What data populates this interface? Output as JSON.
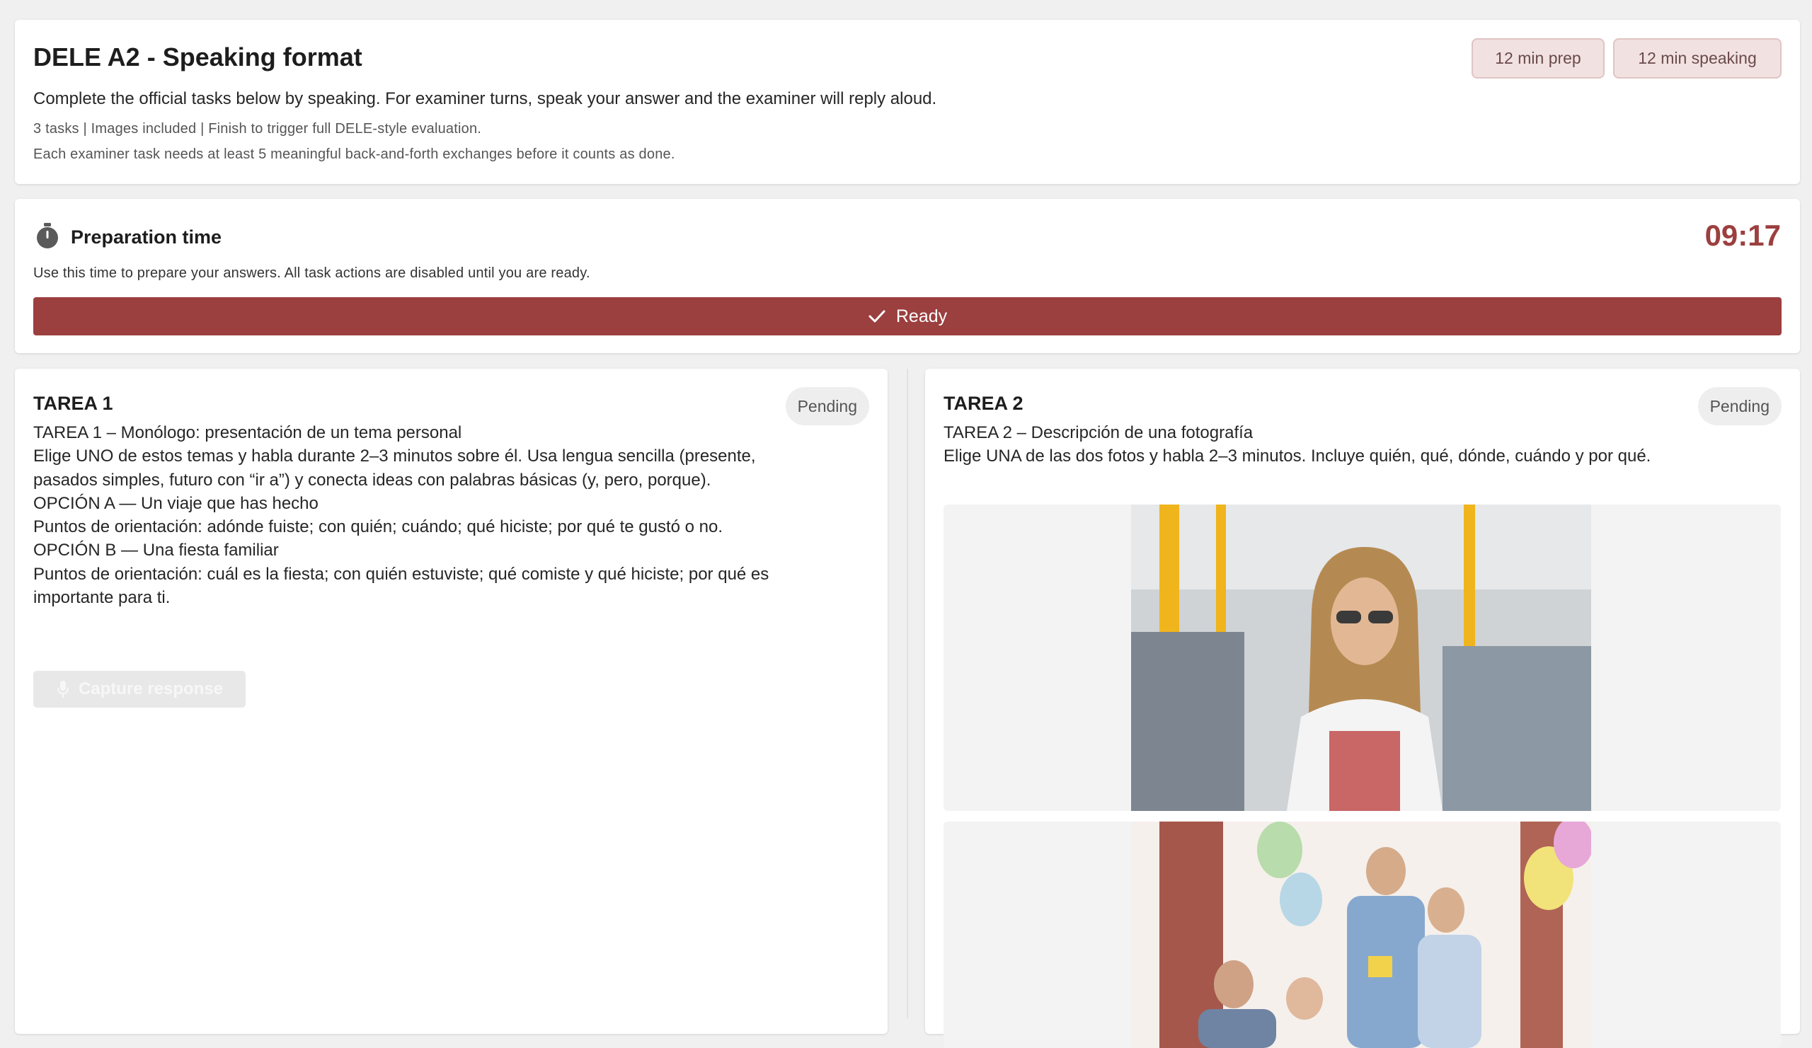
{
  "header": {
    "title": "DELE A2 - Speaking format",
    "subtitle": "Complete the official tasks below by speaking. For examiner turns, speak your answer and the examiner will reply aloud.",
    "meta_line1": "3 tasks | Images included | Finish to trigger full DELE-style evaluation.",
    "meta_line2": "Each examiner task needs at least 5 meaningful back-and-forth exchanges before it counts as done.",
    "chips": [
      "12 min prep",
      "12 min speaking"
    ]
  },
  "prep": {
    "icon": "stopwatch-icon",
    "title": "Preparation time",
    "description": "Use this time to prepare your answers. All task actions are disabled until you are ready.",
    "timer": "09:17",
    "ready_label": "Ready",
    "accent_color": "#9c3f3f"
  },
  "tasks": [
    {
      "title": "TAREA 1",
      "status": "Pending",
      "lines": [
        "TAREA 1 – Monólogo: presentación de un tema personal",
        "Elige UNO de estos temas y habla durante 2–3 minutos sobre él. Usa lengua sencilla (presente, pasados simples, futuro con “ir a”) y conecta ideas con palabras básicas (y, pero, porque).",
        "OPCIÓN A — Un viaje que has hecho",
        "Puntos de orientación: adónde fuiste; con quién; cuándo; qué hiciste; por qué te gustó o no.",
        "OPCIÓN B — Una fiesta familiar",
        "Puntos de orientación: cuál es la fiesta; con quién estuviste; qué comiste y qué hiciste; por qué es importante para ti."
      ],
      "capture_label": "Capture response"
    },
    {
      "title": "TAREA 2",
      "status": "Pending",
      "lines": [
        "TAREA 2 – Descripción de una fotografía",
        "Elige UNA de las dos fotos y habla 2–3 minutos. Incluye quién, qué, dónde, cuándo y por qué."
      ]
    }
  ]
}
